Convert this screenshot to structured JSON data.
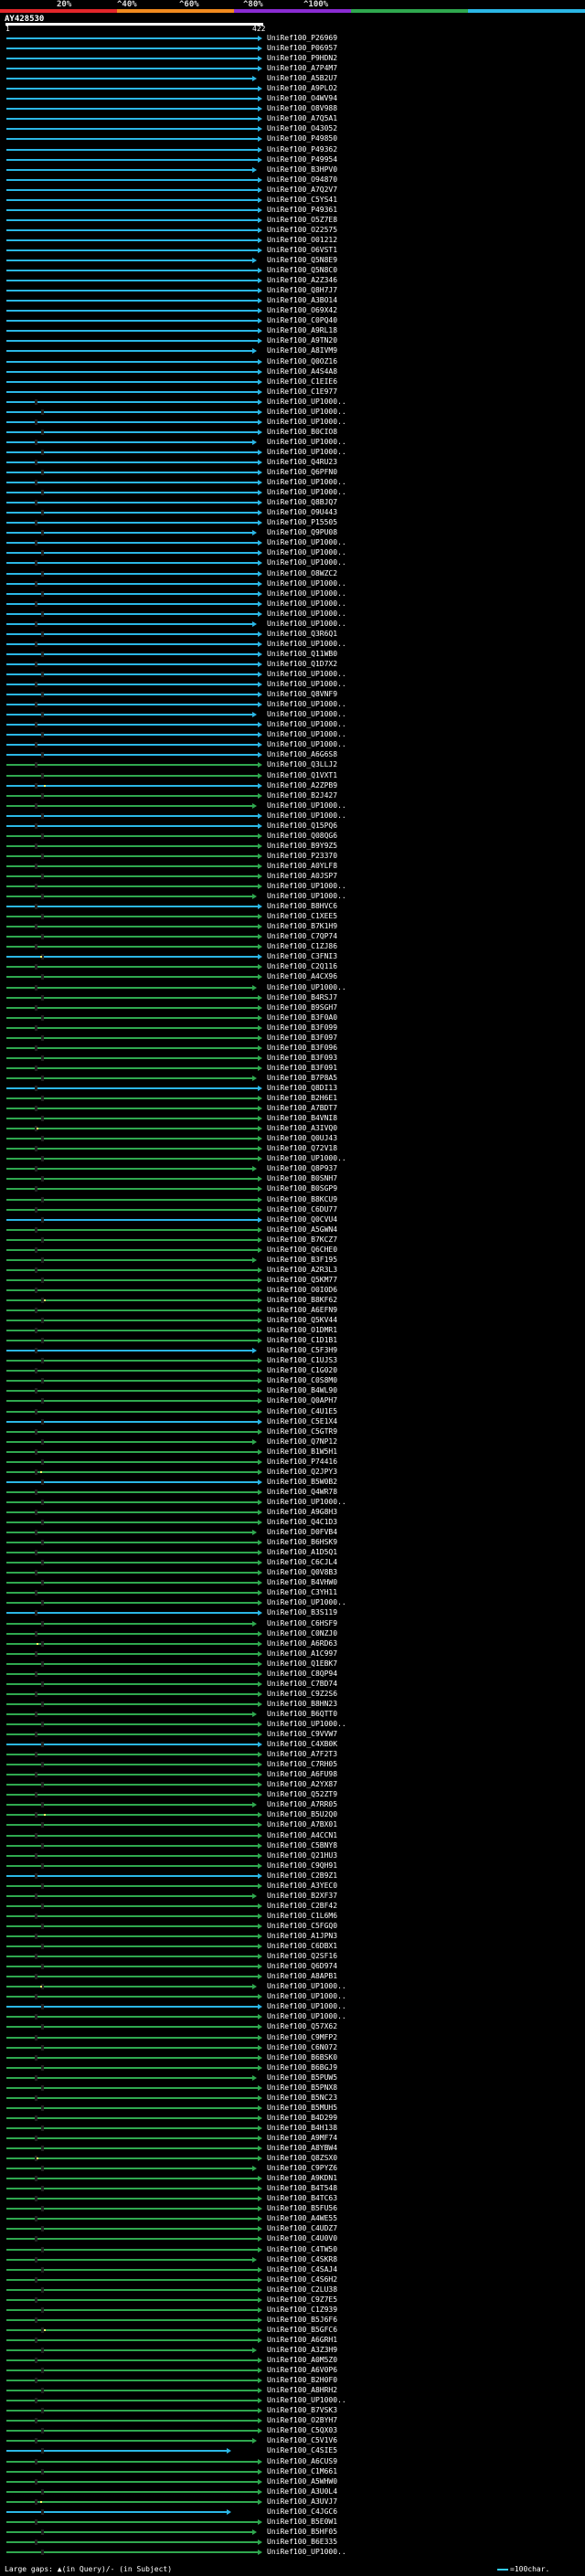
{
  "legend": {
    "labels": [
      "20%",
      "^40%",
      "^60%",
      "^80%",
      "^100%"
    ],
    "colors": [
      "#e3262a",
      "#f28a1e",
      "#8a2bd2",
      "#2fa84f",
      "#2bb7e6"
    ]
  },
  "query": {
    "name": "AY428530",
    "start": "1",
    "end": "422"
  },
  "footer": {
    "gaps_text": "Large gaps: ▲(in Query)/- (in Subject)",
    "scale_text": "=100char."
  },
  "hits": [
    "UniRef100_P26969",
    "UniRef100_P06957",
    "UniRef100_P9HDN2",
    "UniRef100_A7P4M7",
    "UniRef100_A5B2U7",
    "UniRef100_A9PLO2",
    "UniRef100_O4WV94",
    "UniRef100_O8V988",
    "UniRef100_A7Q5A1",
    "UniRef100_O43052",
    "UniRef100_P49850",
    "UniRef100_P49362",
    "UniRef100_P49954",
    "UniRef100_B3HPV0",
    "UniRef100_O94870",
    "UniRef100_A7Q2V7",
    "UniRef100_C5YS41",
    "UniRef100_P49361",
    "UniRef100_O5Z7E8",
    "UniRef100_O22575",
    "UniRef100_O01212",
    "UniRef100_O6VST1",
    "UniRef100_Q5N8E9",
    "UniRef100_Q5N8C0",
    "UniRef100_A2Z346",
    "UniRef100_Q8H7J7",
    "UniRef100_A3BO14",
    "UniRef100_O69X42",
    "UniRef100_C0PQ40",
    "UniRef100_A9RL18",
    "UniRef100_A9TN20",
    "UniRef100_A8IVM9",
    "UniRef100_Q0OZ16",
    "UniRef100_A4S4A8",
    "UniRef100_C1EIE6",
    "UniRef100_C1E977",
    "UniRef100_UP1000..",
    "UniRef100_UP1000..",
    "UniRef100_UP1000..",
    "UniRef100_B0CIO8",
    "UniRef100_UP1000..",
    "UniRef100_UP1000..",
    "UniRef100_Q4RU23",
    "UniRef100_Q6PFN0",
    "UniRef100_UP1000..",
    "UniRef100_UP1000..",
    "UniRef100_Q8BJQ7",
    "UniRef100_O9U443",
    "UniRef100_P15505",
    "UniRef100_Q9PU08",
    "UniRef100_UP1000..",
    "UniRef100_UP1000..",
    "UniRef100_UP1000..",
    "UniRef100_O8WZC2",
    "UniRef100_UP1000..",
    "UniRef100_UP1000..",
    "UniRef100_UP1000..",
    "UniRef100_UP1000..",
    "UniRef100_UP1000..",
    "UniRef100_Q3R6Q1",
    "UniRef100_UP1000..",
    "UniRef100_Q11WB0",
    "UniRef100_Q1D7X2",
    "UniRef100_UP1000..",
    "UniRef100_UP1000..",
    "UniRef100_Q8VNF9",
    "UniRef100_UP1000..",
    "UniRef100_UP1000..",
    "UniRef100_UP1000..",
    "UniRef100_UP1000..",
    "UniRef100_UP1000..",
    "UniRef100_A6G6S8",
    "UniRef100_Q3LLJ2",
    "UniRef100_Q1VXT1",
    "UniRef100_A2ZPB9",
    "UniRef100_B2J427",
    "UniRef100_UP1000..",
    "UniRef100_UP1000..",
    "UniRef100_Q15PQ6",
    "UniRef100_Q08QG6",
    "UniRef100_B9Y9Z5",
    "UniRef100_P23370",
    "UniRef100_A0YLF8",
    "UniRef100_A0JSP7",
    "UniRef100_UP1000..",
    "UniRef100_UP1000..",
    "UniRef100_B8HVC6",
    "UniRef100_C1XEE5",
    "UniRef100_B7K1H9",
    "UniRef100_C7QP74",
    "UniRef100_C1ZJ86",
    "UniRef100_C3FNI3",
    "UniRef100_C2Q116",
    "UniRef100_A4CX96",
    "UniRef100_UP1000..",
    "UniRef100_B4RSJ7",
    "UniRef100_B9SGH7",
    "UniRef100_B3F0A0",
    "UniRef100_B3F099",
    "UniRef100_B3F097",
    "UniRef100_B3F096",
    "UniRef100_B3F093",
    "UniRef100_B3F091",
    "UniRef100_B7P8A5",
    "UniRef100_Q8DI13",
    "UniRef100_B2H6E1",
    "UniRef100_A7BDT7",
    "UniRef100_B4VNI8",
    "UniRef100_A3IVQ0",
    "UniRef100_Q0UJ43",
    "UniRef100_Q72V18",
    "UniRef100_UP1000..",
    "UniRef100_Q8P937",
    "UniRef100_B0SNH7",
    "UniRef100_B0SGP9",
    "UniRef100_B8KCU9",
    "UniRef100_C6DU77",
    "UniRef100_Q0CVU4",
    "UniRef100_A5GWN4",
    "UniRef100_B7KCZ7",
    "UniRef100_Q6CHE0",
    "UniRef100_B3F195",
    "UniRef100_A2R3L3",
    "UniRef100_Q5KM77",
    "UniRef100_O0I0D6",
    "UniRef100_B8KF62",
    "UniRef100_A6EFN9",
    "UniRef100_Q5KV44",
    "UniRef100_O1DMR1",
    "UniRef100_C1D1B1",
    "UniRef100_C5F3H9",
    "UniRef100_C1UJS3",
    "UniRef100_C1G020",
    "UniRef100_C0S8M0",
    "UniRef100_B4WL90",
    "UniRef100_Q0APH7",
    "UniRef100_C4U1E5",
    "UniRef100_C5E1X4",
    "UniRef100_C5GTR9",
    "UniRef100_Q7NP12",
    "UniRef100_B1W5H1",
    "UniRef100_P74416",
    "UniRef100_Q2JPY3",
    "UniRef100_B5W0B2",
    "UniRef100_Q4WR78",
    "UniRef100_UP1000..",
    "UniRef100_A9G8H3",
    "UniRef100_Q4C1D3",
    "UniRef100_D0FVB4",
    "UniRef100_B6HSK9",
    "UniRef100_A1D5Q1",
    "UniRef100_C6CJL4",
    "UniRef100_Q0V8B3",
    "UniRef100_B4VHW0",
    "UniRef100_C3YH11",
    "UniRef100_UP1000..",
    "UniRef100_B3S119",
    "UniRef100_C6HSF9",
    "UniRef100_C0NZJ0",
    "UniRef100_A6RD63",
    "UniRef100_A1C997",
    "UniRef100_Q1EBK7",
    "UniRef100_C8QP94",
    "UniRef100_C7BD74",
    "UniRef100_C9Z2S6",
    "UniRef100_B8HN23",
    "UniRef100_B6QTT0",
    "UniRef100_UP1000..",
    "UniRef100_C9VVW7",
    "UniRef100_C4XB0K",
    "UniRef100_A7F2T3",
    "UniRef100_C7RH05",
    "UniRef100_A6FU98",
    "UniRef100_A2YX87",
    "UniRef100_Q52ZT9",
    "UniRef100_A7RR05",
    "UniRef100_B5U2Q0",
    "UniRef100_A7BX01",
    "UniRef100_A4CCN1",
    "UniRef100_C5BNY8",
    "UniRef100_Q21HU3",
    "UniRef100_C9QH91",
    "UniRef100_C2B9Z1",
    "UniRef100_A3YEC0",
    "UniRef100_B2XF37",
    "UniRef100_C2BF42",
    "UniRef100_C1L6M6",
    "UniRef100_C5FGQ0",
    "UniRef100_A1JPN3",
    "UniRef100_C6DBX1",
    "UniRef100_Q2SF16",
    "UniRef100_Q6D974",
    "UniRef100_A8APB1",
    "UniRef100_UP1000..",
    "UniRef100_UP1000..",
    "UniRef100_UP1000..",
    "UniRef100_UP1000..",
    "UniRef100_Q57X62",
    "UniRef100_C9MFP2",
    "UniRef100_C6N072",
    "UniRef100_B6BSK0",
    "UniRef100_B6BGJ9",
    "UniRef100_B5PUW5",
    "UniRef100_B5PNX8",
    "UniRef100_B5NC23",
    "UniRef100_B5MUH5",
    "UniRef100_B4D299",
    "UniRef100_B4H138",
    "UniRef100_A9MF74",
    "UniRef100_A8YBW4",
    "UniRef100_Q8ZSX0",
    "UniRef100_C9PYZ6",
    "UniRef100_A9KDN1",
    "UniRef100_B4T548",
    "UniRef100_B4TC63",
    "UniRef100_B5FU56",
    "UniRef100_A4WE55",
    "UniRef100_C4UDZ7",
    "UniRef100_C4U0V0",
    "UniRef100_C4TW50",
    "UniRef100_C4SKR8",
    "UniRef100_C4SAJ4",
    "UniRef100_C4S6H2",
    "UniRef100_C2LU38",
    "UniRef100_C9Z7E5",
    "UniRef100_C1Z939",
    "UniRef100_B5J6F6",
    "UniRef100_B5GFC6",
    "UniRef100_A6GRH1",
    "UniRef100_A3Z3H9",
    "UniRef100_A0M5Z0",
    "UniRef100_A6V0P6",
    "UniRef100_B2H0F0",
    "UniRef100_A8HRH2",
    "UniRef100_UP1000..",
    "UniRef100_B7VSK3",
    "UniRef100_O2BYH7",
    "UniRef100_C5QX03",
    "UniRef100_C5V1V6",
    "UniRef100_C4SIE5",
    "UniRef100_A6CUS9",
    "UniRef100_C1M661",
    "UniRef100_A5WHW0",
    "UniRef100_A3U0L4",
    "UniRef100_A3UVJ7",
    "UniRef100_C4JGC6",
    "UniRef100_B5E0W1",
    "UniRef100_B5HF05",
    "UniRef100_B6E335",
    "UniRef100_UP1000.."
  ]
}
